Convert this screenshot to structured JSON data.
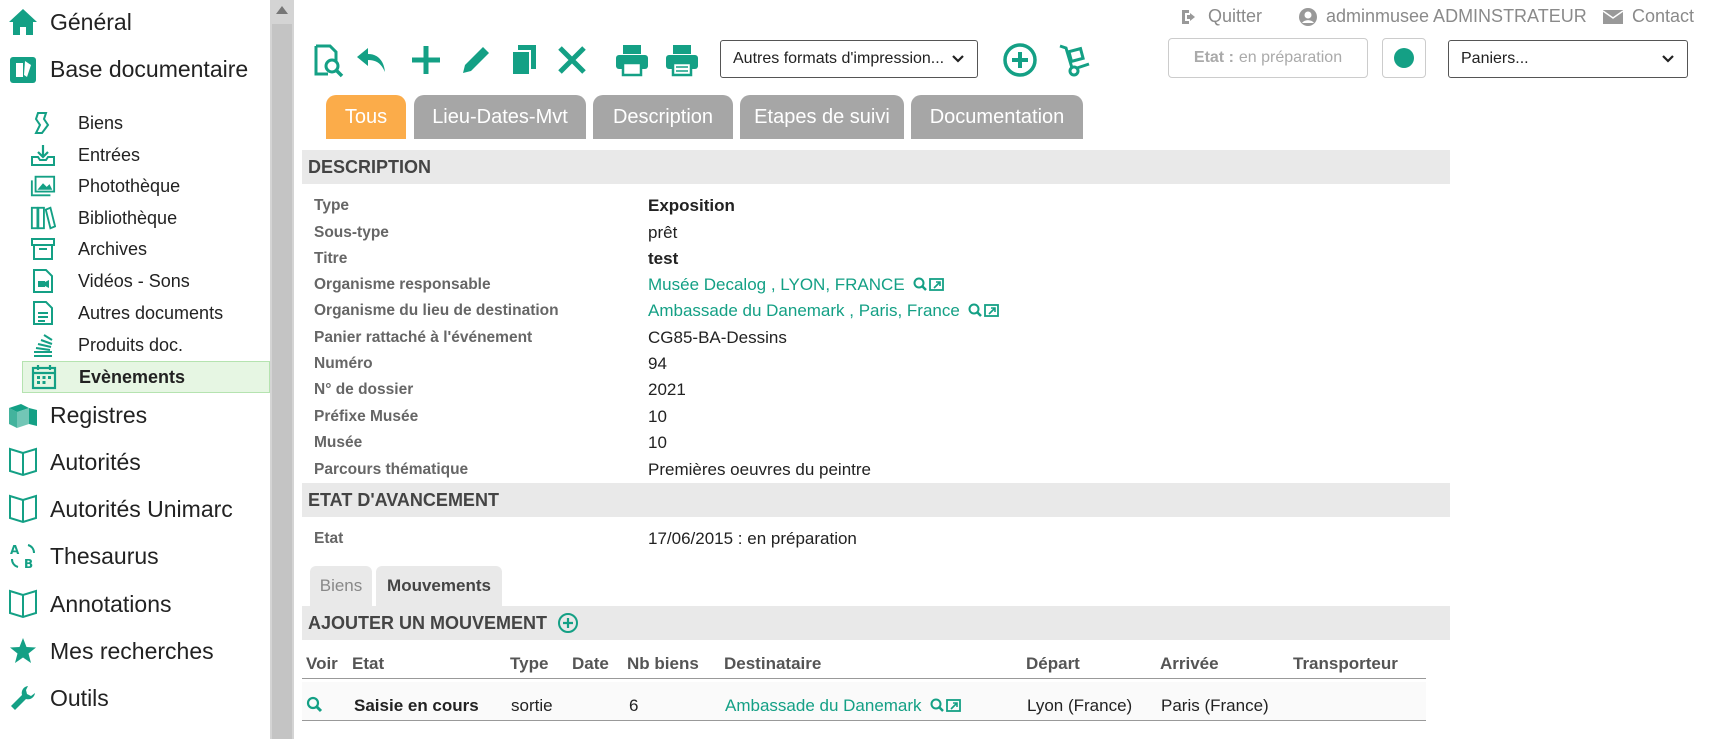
{
  "sidebar": {
    "top_items": [
      {
        "label": "Général",
        "icon": "home-icon"
      },
      {
        "label": "Base documentaire",
        "icon": "documents-icon"
      }
    ],
    "sub_items": [
      {
        "label": "Biens",
        "icon": "object-icon"
      },
      {
        "label": "Entrées",
        "icon": "inbox-icon"
      },
      {
        "label": "Photothèque",
        "icon": "photos-icon"
      },
      {
        "label": "Bibliothèque",
        "icon": "books-icon"
      },
      {
        "label": "Archives",
        "icon": "archive-box-icon"
      },
      {
        "label": "Vidéos - Sons",
        "icon": "video-file-icon"
      },
      {
        "label": "Autres documents",
        "icon": "file-icon"
      },
      {
        "label": "Produits doc.",
        "icon": "stack-icon"
      },
      {
        "label": "Evènements",
        "icon": "calendar-icon"
      }
    ],
    "bottom_items": [
      {
        "label": "Registres",
        "icon": "registers-icon"
      },
      {
        "label": "Autorités",
        "icon": "open-book-icon"
      },
      {
        "label": "Autorités Unimarc",
        "icon": "open-book-icon"
      },
      {
        "label": "Thesaurus",
        "icon": "thesaurus-icon"
      },
      {
        "label": "Annotations",
        "icon": "open-book-icon"
      },
      {
        "label": "Mes recherches",
        "icon": "star-icon"
      },
      {
        "label": "Outils",
        "icon": "wrench-icon"
      }
    ]
  },
  "topbar": {
    "quit": "Quitter",
    "user": "adminmusee ADMINSTRATEUR",
    "contact": "Contact"
  },
  "toolbar": {
    "print_formats": "Autres formats d'impression...",
    "etat_label": "Etat :",
    "etat_value": "en préparation",
    "paniers": "Paniers..."
  },
  "tabs": [
    "Tous",
    "Lieu-Dates-Mvt",
    "Description",
    "Etapes de suivi",
    "Documentation"
  ],
  "description": {
    "header": "DESCRIPTION",
    "rows": [
      {
        "label": "Type",
        "value": "Exposition"
      },
      {
        "label": "Sous-type",
        "value": "prêt"
      },
      {
        "label": "Titre",
        "value": "test"
      },
      {
        "label": "Organisme responsable",
        "value": "Musée Decalog , LYON, FRANCE"
      },
      {
        "label": "Organisme du lieu de destination",
        "value": "Ambassade du Danemark , Paris, France"
      },
      {
        "label": "Panier rattaché à l'événement",
        "value": "CG85-BA-Dessins"
      },
      {
        "label": "Numéro",
        "value": "94"
      },
      {
        "label": "N° de dossier",
        "value": "2021"
      },
      {
        "label": "Préfixe Musée",
        "value": "10"
      },
      {
        "label": "Musée",
        "value": "10"
      },
      {
        "label": "Parcours thématique",
        "value": "Premières oeuvres du peintre"
      }
    ]
  },
  "etat_avancement": {
    "header": "ETAT D'AVANCEMENT",
    "label": "Etat",
    "value": "17/06/2015 : en préparation"
  },
  "subtabs": [
    "Biens",
    "Mouvements"
  ],
  "mouvements": {
    "header": "AJOUTER UN MOUVEMENT",
    "columns": [
      "Voir",
      "Etat",
      "Type",
      "Date",
      "Nb biens",
      "Destinataire",
      "Départ",
      "Arrivée",
      "Transporteur"
    ],
    "rows": [
      {
        "etat": "Saisie en cours",
        "type": "sortie",
        "date": "",
        "nb_biens": "6",
        "destinataire": "Ambassade du Danemark",
        "depart": "Lyon (France)",
        "arrivee": "Paris (France)",
        "transporteur": ""
      }
    ]
  },
  "colors": {
    "accent": "#14a085",
    "tab_active": "#fbac4a",
    "tab_inactive": "#a6a6a6"
  }
}
